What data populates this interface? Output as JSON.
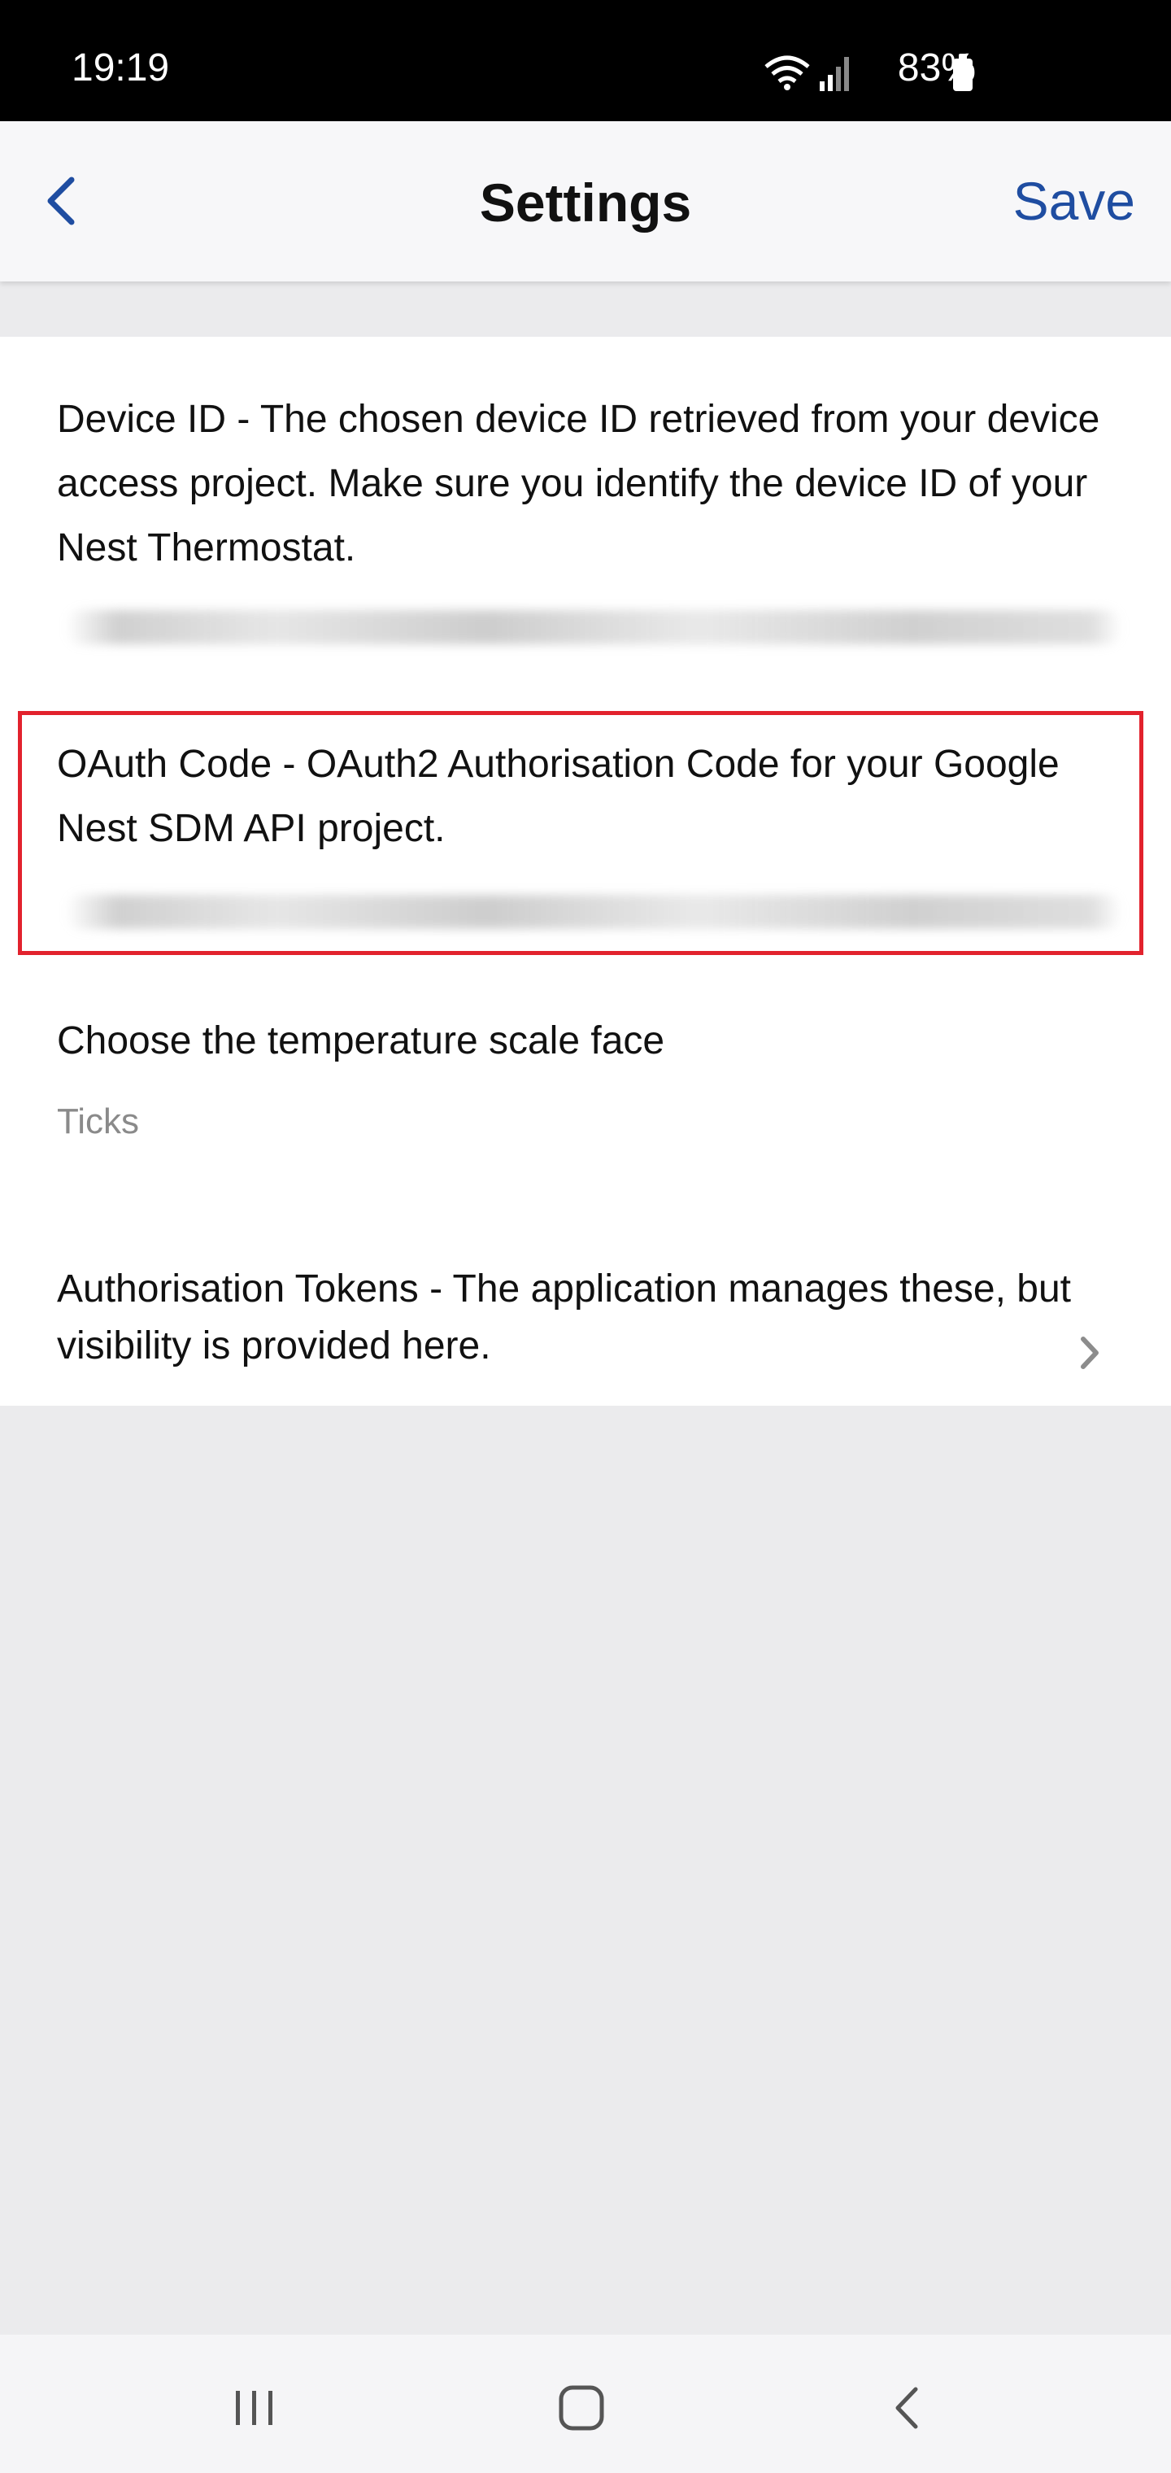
{
  "status_bar": {
    "time": "19:19",
    "battery": "83%",
    "icons": [
      "wifi-icon",
      "signal-icon",
      "battery-icon"
    ]
  },
  "header": {
    "title": "Settings",
    "save_label": "Save",
    "back_icon": "chevron-left-icon",
    "accent_color": "#1f4da1"
  },
  "settings": [
    {
      "label": "Device ID - The chosen device ID retrieved from your device access project. Make sure you identify the device ID of your Nest Thermostat."
    },
    {
      "label": "OAuth Code - OAuth2 Authorisation Code for your Google Nest SDM API project.",
      "highlight_color": "#e2222d"
    },
    {
      "label": "Choose the temperature scale face",
      "value": "Ticks"
    },
    {
      "label": "Authorisation Tokens - The application manages these, but visibility is provided here.",
      "icon": "chevron-right-icon"
    }
  ],
  "system_nav": {
    "icons": [
      "recent-apps-icon",
      "home-icon",
      "back-icon"
    ]
  }
}
